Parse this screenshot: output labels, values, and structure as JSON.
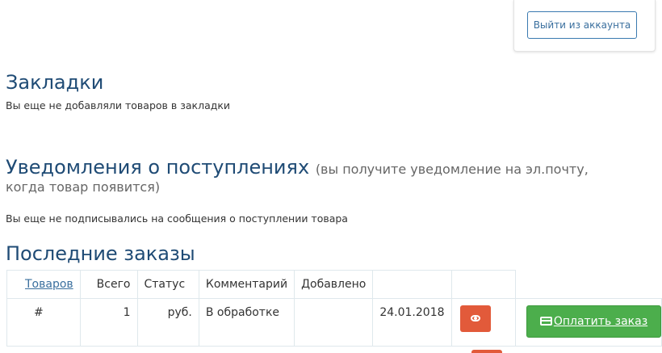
{
  "account": {
    "logout_label": "Выйти из аккаунта"
  },
  "bookmarks": {
    "title": "Закладки",
    "empty_text": "Вы еще не добавляли товаров в закладки"
  },
  "notifications": {
    "title": "Уведомления о поступлениях",
    "note_line1": "(вы получите уведомление на эл.почту,",
    "note_line2": "когда товар появится)",
    "empty_text": "Вы еще не подписывались на сообщения о поступлении товара"
  },
  "orders": {
    "title": "Последние заказы",
    "columns": [
      "Товаров",
      "Всего",
      "Статус",
      "Комментарий",
      "Добавлено",
      "",
      ""
    ],
    "rows": [
      {
        "num": "#",
        "items": "1",
        "total": "руб.",
        "status": "В обработке",
        "comment": "",
        "added": "24.01.2018",
        "view_icon": "eye-icon",
        "pay_label": "Оплатить заказ",
        "pay_icon": "credit-card-icon"
      }
    ]
  },
  "colors": {
    "heading": "#1f4b75",
    "link": "#3a6f9e",
    "view_button": "#e25a3a",
    "pay_button": "#4cae4c",
    "table_border": "#dfe8ec"
  }
}
